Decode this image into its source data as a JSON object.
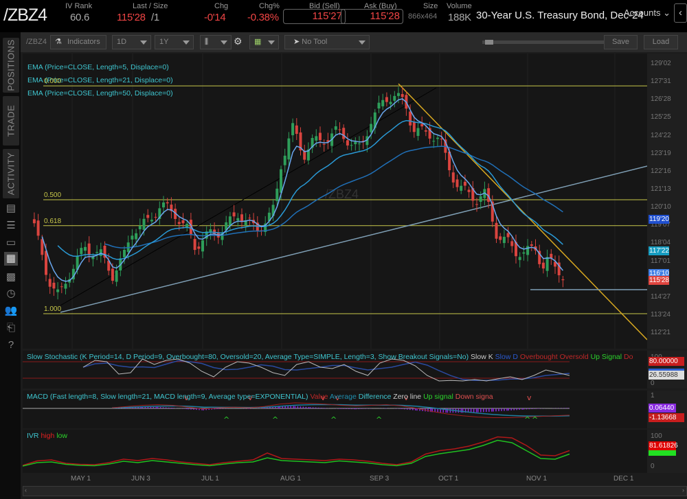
{
  "header": {
    "symbol": "/ZBZ4",
    "iv_rank_label": "IV Rank",
    "iv_rank": "60.6",
    "last_label": "Last / Size",
    "last": "115'28",
    "size": "/1",
    "chg_label": "Chg",
    "chg": "-0'14",
    "chgpct_label": "Chg%",
    "chgpct": "-0.38%",
    "bid_label": "Bid (Sell)",
    "bid": "115'27",
    "ask_label": "Ask (Buy)",
    "ask": "115'28",
    "size_label": "Size",
    "bidask_size": "866x464",
    "volume_label": "Volume",
    "volume": "188K",
    "description": "30-Year U.S. Treasury Bond, Dec-24",
    "accounts": "Accounts"
  },
  "sidebar": {
    "tabs": [
      "POSITIONS",
      "TRADE",
      "ACTIVITY"
    ],
    "icons": [
      "news-icon",
      "watchlist-icon",
      "tv-icon",
      "chart-icon",
      "grid-icon",
      "history-icon",
      "people-icon",
      "transfer-icon",
      "help-icon"
    ]
  },
  "toolbar": {
    "symbol": "/ZBZ4",
    "indicators": "Indicators",
    "aggregation": "1D",
    "time_frame": "1Y",
    "drawing_tool": "No Tool",
    "save": "Save",
    "load": "Load"
  },
  "studies": {
    "ema": [
      "EMA (Price=CLOSE, Length=5, Displace=0)",
      "EMA (Price=CLOSE, Length=21, Displace=0)",
      "EMA (Price=CLOSE, Length=50, Displace=0)"
    ],
    "watermark": "/ZBZ4",
    "stoch": {
      "title": "Slow Stochastic (K Period=14, D Period=9, Overbought=80, Oversold=20, Average Type=SIMPLE, Length=3, Show Breakout Signals=No)",
      "legend": [
        "Slow K",
        "Slow D",
        "Overbought",
        "Oversold",
        "Up Signal",
        "Do"
      ],
      "axis": [
        "100",
        "0"
      ],
      "badges": [
        "80.00000",
        "26.55988"
      ]
    },
    "macd": {
      "title": "MACD (Fast length=8, Slow length=21, MACD length=9, Average type=EXPONENTIAL)",
      "legend": [
        "Value",
        "Average",
        "Difference",
        "Zero line",
        "Up signal",
        "Down signa"
      ],
      "axis": [
        "1"
      ],
      "badges": [
        "0.06440",
        "-1.13668"
      ]
    },
    "ivr": {
      "title": "IVR",
      "legend": [
        "high",
        "low"
      ],
      "axis": [
        "100",
        "0"
      ],
      "badges": [
        "81.61826",
        ""
      ]
    }
  },
  "fib_levels": [
    {
      "label": "0.000",
      "price": 127.72
    },
    {
      "label": "0.500",
      "price": 120.78
    },
    {
      "label": "0.618",
      "price": 119.2
    },
    {
      "label": "1.000",
      "price": 113.83
    }
  ],
  "price_axis": [
    "129'02",
    "127'31",
    "126'28",
    "125'25",
    "124'22",
    "123'19",
    "122'16",
    "121'13",
    "120'10",
    "119'07",
    "118'04",
    "117'01",
    "114'27",
    "113'24",
    "112'21"
  ],
  "price_badges": [
    {
      "text": "119'20",
      "color": "#1f4fcf"
    },
    {
      "text": "117'22",
      "color": "#159cc0"
    },
    {
      "text": "116'10",
      "color": "#3f7fe6"
    },
    {
      "text": "115'28",
      "color": "#e0453f"
    }
  ],
  "date_axis": [
    {
      "label": "MAY 1",
      "date": "2024-05-01"
    },
    {
      "label": "JUN 3",
      "date": "2024-06-03"
    },
    {
      "label": "JUL 1",
      "date": "2024-07-01"
    },
    {
      "label": "AUG 1",
      "date": "2024-08-01"
    },
    {
      "label": "SEP 3",
      "date": "2024-09-03"
    },
    {
      "label": "OCT 1",
      "date": "2024-10-01"
    },
    {
      "label": "NOV 1",
      "date": "2024-11-01"
    },
    {
      "label": "DEC 1",
      "date": "2024-12-01"
    }
  ],
  "colors": {
    "up": "#2e9e5a",
    "down": "#d9443f",
    "ema5": "#6aa8f0",
    "ema21": "#2a9ad6",
    "ema50": "#2070b8",
    "fib": "#c8c84a",
    "accent": "#3fc6d0"
  },
  "chart_data": {
    "type": "candlestick",
    "closes": [
      [
        "2024-04-12",
        119.1
      ],
      [
        "2024-04-16",
        117.4
      ],
      [
        "2024-04-19",
        116.2
      ],
      [
        "2024-04-24",
        115.0
      ],
      [
        "2024-04-26",
        115.2
      ],
      [
        "2024-05-01",
        116.4
      ],
      [
        "2024-05-08",
        117.9
      ],
      [
        "2024-05-16",
        117.7
      ],
      [
        "2024-05-23",
        116.0
      ],
      [
        "2024-05-29",
        117.1
      ],
      [
        "2024-06-03",
        119.1
      ],
      [
        "2024-06-10",
        119.6
      ],
      [
        "2024-06-14",
        120.2
      ],
      [
        "2024-06-20",
        120.0
      ],
      [
        "2024-06-25",
        119.1
      ],
      [
        "2024-06-28",
        117.9
      ],
      [
        "2024-07-02",
        118.3
      ],
      [
        "2024-07-08",
        118.9
      ],
      [
        "2024-07-10",
        119.4
      ],
      [
        "2024-07-15",
        120.0
      ],
      [
        "2024-07-18",
        119.4
      ],
      [
        "2024-07-22",
        118.7
      ],
      [
        "2024-07-29",
        120.4
      ],
      [
        "2024-08-01",
        123.3
      ],
      [
        "2024-08-05",
        125.0
      ],
      [
        "2024-08-09",
        123.3
      ],
      [
        "2024-08-12",
        124.4
      ],
      [
        "2024-08-16",
        124.6
      ],
      [
        "2024-08-21",
        124.8
      ],
      [
        "2024-08-26",
        124.2
      ],
      [
        "2024-08-30",
        124.0
      ],
      [
        "2024-09-03",
        125.8
      ],
      [
        "2024-09-09",
        126.7
      ],
      [
        "2024-09-13",
        127.1
      ],
      [
        "2024-09-17",
        126.7
      ],
      [
        "2024-09-20",
        125.4
      ],
      [
        "2024-09-26",
        124.6
      ],
      [
        "2024-10-01",
        124.4
      ],
      [
        "2024-10-04",
        122.9
      ],
      [
        "2024-10-08",
        121.7
      ],
      [
        "2024-10-14",
        120.6
      ],
      [
        "2024-10-17",
        121.0
      ],
      [
        "2024-10-21",
        118.9
      ],
      [
        "2024-10-25",
        118.3
      ],
      [
        "2024-10-28",
        117.5
      ],
      [
        "2024-10-31",
        117.3
      ],
      [
        "2024-11-04",
        117.9
      ],
      [
        "2024-11-06",
        116.8
      ],
      [
        "2024-11-08",
        117.3
      ],
      [
        "2024-11-12",
        116.4
      ],
      [
        "2024-11-14",
        115.875
      ]
    ],
    "ylim": [
      112.4,
      129.4
    ],
    "stoch_k": [
      60,
      85,
      80,
      35,
      40,
      90,
      70,
      85,
      90,
      75,
      45,
      25,
      60,
      80,
      75,
      60,
      40,
      30,
      70,
      80,
      60,
      55,
      70,
      45,
      30,
      75,
      90,
      85,
      65,
      30,
      10,
      12,
      10,
      15,
      10,
      18,
      25,
      15,
      30,
      50,
      40,
      30
    ],
    "macd": [
      0.1,
      0.3,
      0.5,
      0.6,
      0.5,
      0.2,
      -0.1,
      0.1,
      0.2,
      0.1,
      0.3,
      0.7,
      0.9,
      0.8,
      0.7,
      0.5,
      0.4,
      0.5,
      0.6,
      0.4,
      0.0,
      -0.5,
      -0.9,
      -1.2,
      -1.4,
      -1.5,
      -1.5,
      -1.4,
      -1.3,
      -1.2,
      -1.1
    ],
    "ivr_high": [
      12,
      25,
      28,
      18,
      15,
      14,
      20,
      30,
      26,
      32,
      28,
      22,
      18,
      14,
      20,
      24,
      28,
      48,
      32,
      30,
      28,
      26,
      30,
      28,
      24,
      18,
      14,
      22,
      45,
      55,
      60,
      68,
      80,
      95,
      92,
      70,
      42,
      40,
      55
    ],
    "ivr_low": [
      10,
      20,
      22,
      15,
      12,
      11,
      16,
      24,
      20,
      26,
      22,
      18,
      14,
      11,
      16,
      20,
      22,
      34,
      26,
      24,
      22,
      20,
      25,
      22,
      19,
      14,
      11,
      18,
      38,
      46,
      52,
      58,
      70,
      85,
      78,
      55,
      32,
      30,
      45
    ]
  }
}
